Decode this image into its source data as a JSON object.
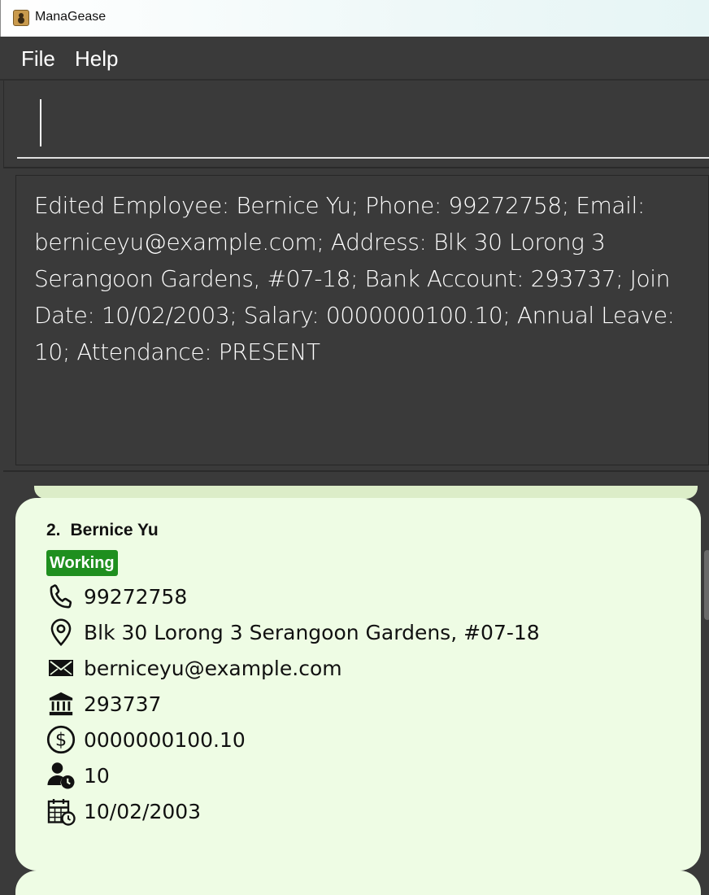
{
  "window": {
    "title": "ManaGease"
  },
  "menu": {
    "file": "File",
    "help": "Help"
  },
  "command": {
    "value": "",
    "placeholder": ""
  },
  "result": {
    "message": "Edited Employee: Bernice Yu; Phone: 99272758; Email: berniceyu@example.com; Address: Blk 30 Lorong 3 Serangoon Gardens, #07-18; Bank Account: 293737; Join Date: 10/02/2003; Salary: 0000000100.10; Annual Leave: 10; Attendance: PRESENT"
  },
  "employee": {
    "index": "2.",
    "name": "Bernice Yu",
    "status": "Working",
    "phone": "99272758",
    "address": "Blk 30 Lorong 3 Serangoon Gardens, #07-18",
    "email": "berniceyu@example.com",
    "bank_account": "293737",
    "salary": "0000000100.10",
    "annual_leave": "10",
    "join_date": "10/02/2003"
  },
  "icons": {
    "phone": "phone-icon",
    "address": "location-pin-icon",
    "email": "envelope-icon",
    "bank": "bank-icon",
    "salary": "dollar-icon",
    "leave": "person-clock-icon",
    "date": "calendar-clock-icon"
  },
  "colors": {
    "background": "#3a3a3a",
    "card": "#eefce4",
    "badge": "#1f8f1f"
  }
}
